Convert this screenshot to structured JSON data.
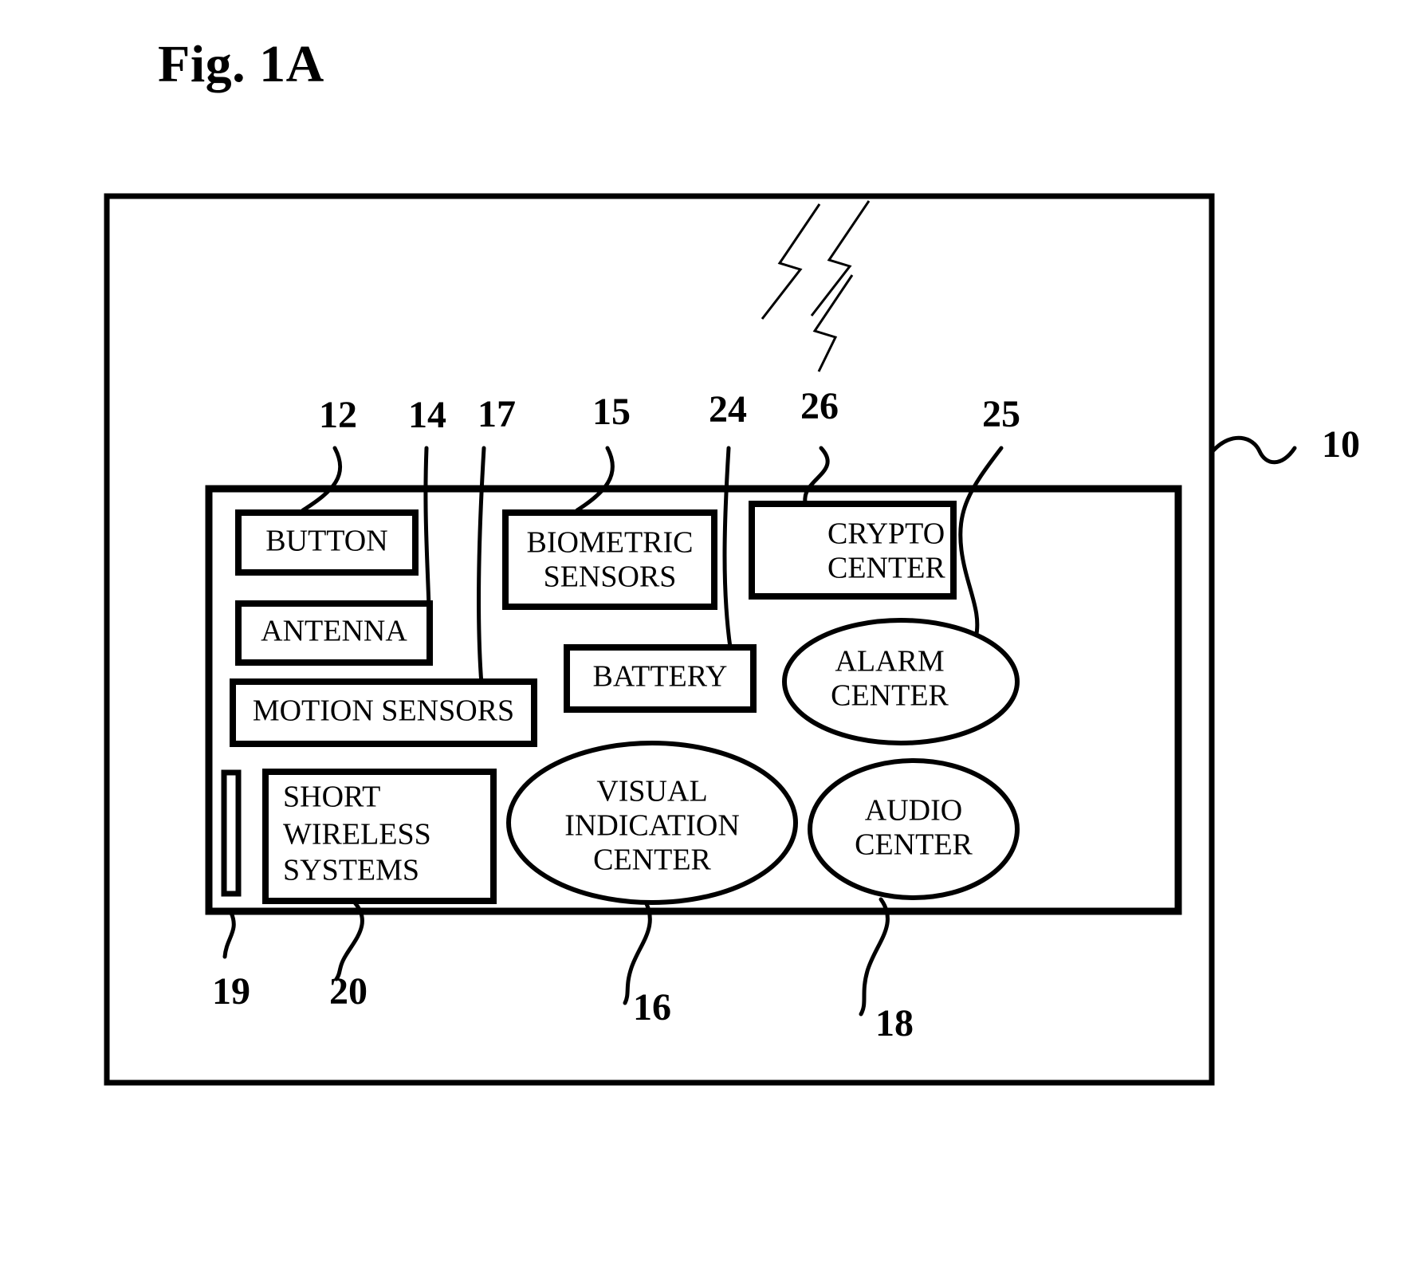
{
  "figure": {
    "title": "Fig. 1A",
    "assembly_ref": "10"
  },
  "components": {
    "boxes": [
      {
        "id": "button",
        "label": "BUTTON",
        "ref": "12"
      },
      {
        "id": "antenna",
        "label": "ANTENNA",
        "ref": "14"
      },
      {
        "id": "motion",
        "label": "MOTION SENSORS",
        "ref": "17"
      },
      {
        "id": "biometric",
        "label_line1": "BIOMETRIC",
        "label_line2": "SENSORS",
        "ref": "15"
      },
      {
        "id": "crypto",
        "label_line1": "CRYPTO",
        "label_line2": "CENTER",
        "ref": "26"
      },
      {
        "id": "battery",
        "label": "BATTERY",
        "ref": "24"
      },
      {
        "id": "shortwl",
        "label_line1": "SHORT",
        "label_line2": "WIRELESS",
        "label_line3": "SYSTEMS",
        "ref": "20"
      },
      {
        "id": "bar",
        "label": "",
        "ref": "19"
      }
    ],
    "ellipses": [
      {
        "id": "alarm",
        "label_line1": "ALARM",
        "label_line2": "CENTER",
        "ref": "25"
      },
      {
        "id": "visual",
        "label_line1": "VISUAL",
        "label_line2": "INDICATION",
        "label_line3": "CENTER",
        "ref": "16"
      },
      {
        "id": "audio",
        "label_line1": "AUDIO",
        "label_line2": "CENTER",
        "ref": "18"
      }
    ]
  },
  "reference_numerals": {
    "n12": "12",
    "n14": "14",
    "n17": "17",
    "n15": "15",
    "n24": "24",
    "n26": "26",
    "n25": "25",
    "n10": "10",
    "n19": "19",
    "n20": "20",
    "n16": "16",
    "n18": "18"
  },
  "colors": {
    "stroke": "#000000",
    "fill": "#ffffff"
  }
}
